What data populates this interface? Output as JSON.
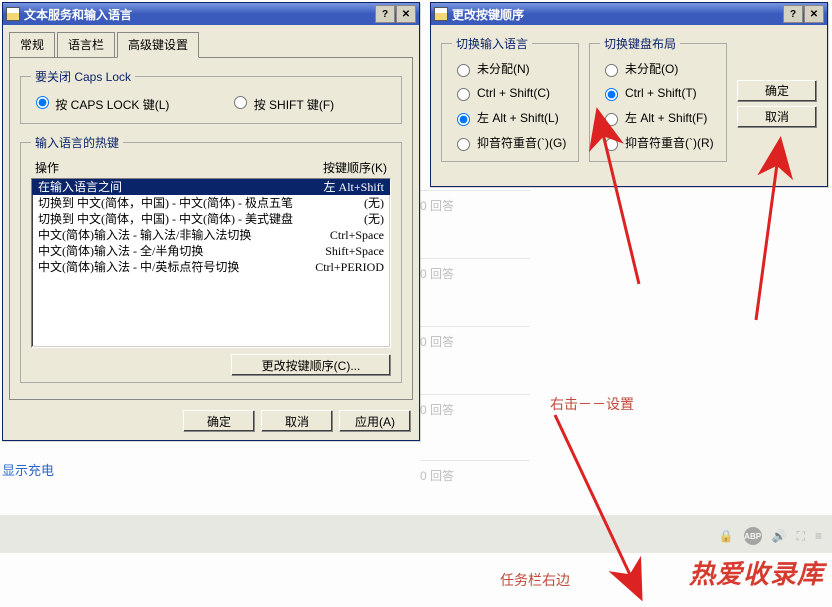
{
  "window1": {
    "title": "文本服务和输入语言",
    "tabs": [
      "常规",
      "语言栏",
      "高级键设置"
    ],
    "active_tab": 2,
    "capslock": {
      "legend": "要关闭 Caps Lock",
      "opt1": "按 CAPS LOCK 键(L)",
      "opt2": "按 SHIFT 键(F)"
    },
    "hotkeys": {
      "legend": "输入语言的热键",
      "col_action": "操作",
      "col_key": "按键顺序(K)",
      "rows": [
        {
          "action": "在输入语言之间",
          "key": "左 Alt+Shift",
          "hi": true
        },
        {
          "action": "切换到 中文(简体，中国) - 中文(简体) - 极点五笔",
          "key": "(无)"
        },
        {
          "action": "切换到 中文(简体，中国) - 中文(简体) - 美式键盘",
          "key": "(无)"
        },
        {
          "action": "中文(简体)输入法 - 输入法/非输入法切换",
          "key": "Ctrl+Space"
        },
        {
          "action": "中文(简体)输入法 - 全/半角切换",
          "key": "Shift+Space"
        },
        {
          "action": "中文(简体)输入法 - 中/英标点符号切换",
          "key": "Ctrl+PERIOD"
        }
      ],
      "change_btn": "更改按键顺序(C)..."
    },
    "buttons": {
      "ok": "确定",
      "cancel": "取消",
      "apply": "应用(A)"
    }
  },
  "window2": {
    "title": "更改按键顺序",
    "group_lang": {
      "legend": "切换输入语言",
      "opts": [
        "未分配(N)",
        "Ctrl + Shift(C)",
        "左 Alt + Shift(L)",
        "抑音符重音(`)(G)"
      ],
      "selected": 2
    },
    "group_layout": {
      "legend": "切换键盘布局",
      "opts": [
        "未分配(O)",
        "Ctrl + Shift(T)",
        "左 Alt + Shift(F)",
        "抑音符重音(`)(R)"
      ],
      "selected": 1
    },
    "buttons": {
      "ok": "确定",
      "cancel": "取消"
    }
  },
  "background": {
    "answer_label": "回答",
    "answer_count": "0",
    "note_right_click": "右击－－设置",
    "note_taskbar": "任务栏右边",
    "link_show_charge": "显示充电",
    "footer_brand": "热爱收录库"
  }
}
